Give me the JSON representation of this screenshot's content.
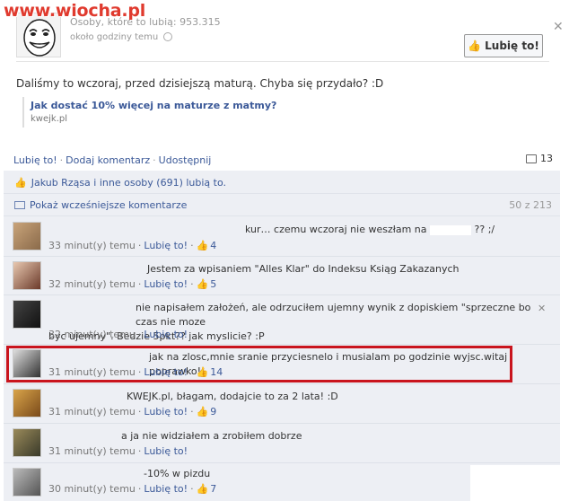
{
  "watermark": "www.wiocha.pl",
  "post": {
    "meta_likes": "Osoby, które to lubią: 953.315",
    "meta_time": "około godziny temu",
    "like_page_label": "Lubię to!",
    "text": "Daliśmy to wczoraj, przed dzisiejszą maturą. Chyba się przydało? :D",
    "link_title": "Jak dostać 10% więcej na maturze z matmy?",
    "link_domain": "kwejk.pl"
  },
  "actions": {
    "like": "Lubię to!",
    "comment": "Dodaj komentarz",
    "share": "Udostępnij",
    "count": "13"
  },
  "feedback": {
    "likers": "Jakub Rząsa i inne osoby (691) lubią to.",
    "prev_comments": "Pokaż wcześniejsze komentarze",
    "prev_count": "50 z 213"
  },
  "comments": [
    {
      "text_a": "kur… czemu wczoraj nie weszłam na",
      "text_b": "?? ;/",
      "time": "33 minut(y) temu",
      "like": "Lubię to!",
      "likes": "4"
    },
    {
      "text": "Jestem za wpisaniem \"Alles Klar\" do Indeksu Ksiąg Zakazanych",
      "time": "32 minut(y) temu",
      "like": "Lubię to!",
      "likes": "5"
    },
    {
      "text_line1": "nie napisałem założeń, ale odrzuciłem ujemny wynik z dopiskiem \"sprzeczne bo czas nie moze",
      "text_line2": "byc ujemny\". Bedzie 5pkt?? jak myslicie? :P",
      "time": "32 minut(y) temu",
      "like": "Lubię to!"
    },
    {
      "text": "jak na zlosc,mnie sranie przyciesnelo i musialam po godzinie wyjsc.witaj poprawko!",
      "time": "31 minut(y) temu",
      "like": "Lubię to!",
      "likes": "14"
    },
    {
      "text": "KWEJK.pl, błagam, dodajcie to za 2 lata! :D",
      "time": "31 minut(y) temu",
      "like": "Lubię to!",
      "likes": "9"
    },
    {
      "text": "a ja nie widziałem a zrobiłem dobrze",
      "time": "31 minut(y) temu",
      "like": "Lubię to!"
    },
    {
      "text": "-10% w pizdu",
      "time": "30 minut(y) temu",
      "like": "Lubię to!",
      "likes": "7"
    }
  ],
  "colors": {
    "link": "#3b5998",
    "highlight": "#c9141d",
    "watermark": "#e03a2e",
    "feedback_bg": "#edeff4"
  }
}
